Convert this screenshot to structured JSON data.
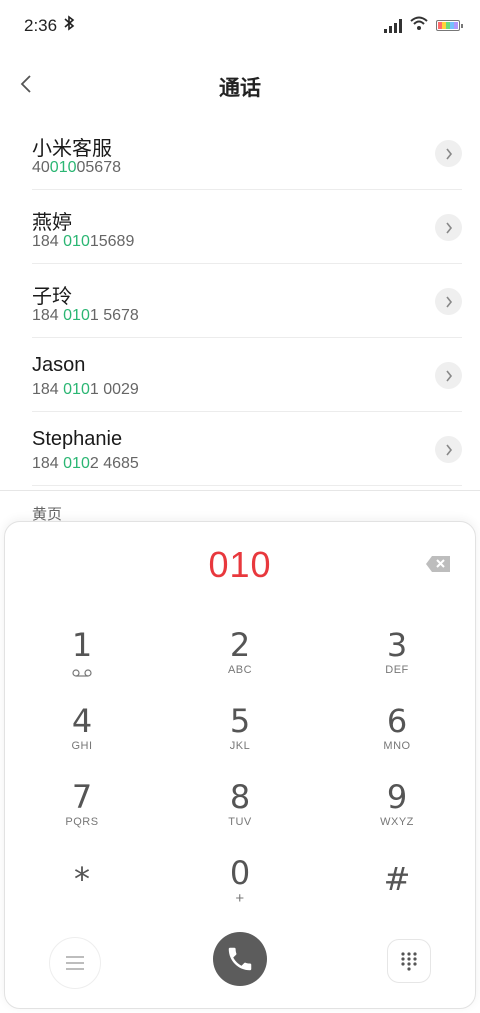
{
  "status": {
    "time": "2:36"
  },
  "header": {
    "title": "通话"
  },
  "contacts": [
    {
      "name": "小米客服",
      "num_pre": "40",
      "num_hl": "010",
      "num_post": "05678"
    },
    {
      "name": "燕婷",
      "num_pre": "184 ",
      "num_hl": "010",
      "num_post": "15689"
    },
    {
      "name": "子玲",
      "num_pre": "184 ",
      "num_hl": "010",
      "num_post": "1 5678"
    },
    {
      "name": "Jason",
      "num_pre": "184 ",
      "num_hl": "010",
      "num_post": "1 0029"
    },
    {
      "name": "Stephanie",
      "num_pre": "184 ",
      "num_hl": "010",
      "num_post": "2 4685"
    }
  ],
  "section": {
    "label": "黄页"
  },
  "dialer": {
    "input": "010",
    "keys": [
      {
        "digit": "1",
        "letters": ""
      },
      {
        "digit": "2",
        "letters": "ABC"
      },
      {
        "digit": "3",
        "letters": "DEF"
      },
      {
        "digit": "4",
        "letters": "GHI"
      },
      {
        "digit": "5",
        "letters": "JKL"
      },
      {
        "digit": "6",
        "letters": "MNO"
      },
      {
        "digit": "7",
        "letters": "PQRS"
      },
      {
        "digit": "8",
        "letters": "TUV"
      },
      {
        "digit": "9",
        "letters": "WXYZ"
      },
      {
        "digit": "*",
        "letters": ""
      },
      {
        "digit": "0",
        "letters": "+"
      },
      {
        "digit": "#",
        "letters": ""
      }
    ]
  },
  "colors": {
    "highlight": "#2bb673",
    "input": "#e8383d",
    "call": "#5c5c5c"
  },
  "icons": {
    "bluetooth": "bluetooth-icon",
    "signal": "signal-icon",
    "wifi": "wifi-icon",
    "battery": "battery-icon",
    "back": "back-arrow-icon",
    "chevron": "chevron-right-icon",
    "delete": "backspace-icon",
    "voicemail": "voicemail-icon",
    "menu": "menu-icon",
    "call": "phone-icon",
    "dialpad": "dialpad-icon"
  }
}
